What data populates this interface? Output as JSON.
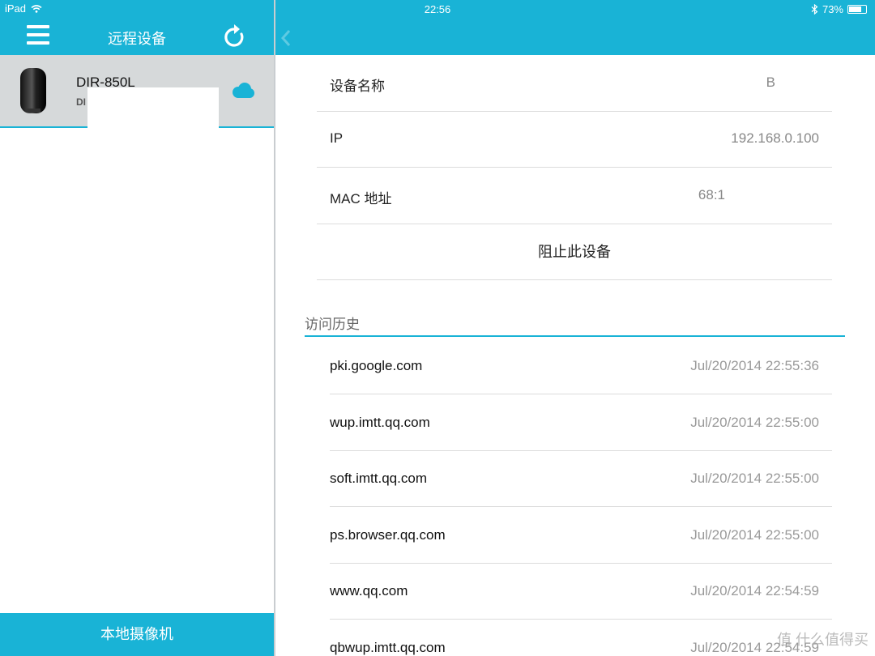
{
  "status_bar": {
    "carrier": "iPad",
    "time": "22:56",
    "battery": "73%"
  },
  "left_pane": {
    "title": "远程设备",
    "device": {
      "name": "DIR-850L",
      "subtitle": "DI"
    },
    "footer_label": "本地摄像机"
  },
  "detail": {
    "rows": [
      {
        "label": "设备名称",
        "value": "B"
      },
      {
        "label": "IP",
        "value": "192.168.0.100"
      },
      {
        "label": "MAC 地址",
        "value": "68:1"
      }
    ],
    "block_label": "阻止此设备",
    "history_title": "访问历史",
    "history": [
      {
        "domain": "pki.google.com",
        "time": "Jul/20/2014 22:55:36"
      },
      {
        "domain": "wup.imtt.qq.com",
        "time": "Jul/20/2014 22:55:00"
      },
      {
        "domain": "soft.imtt.qq.com",
        "time": "Jul/20/2014 22:55:00"
      },
      {
        "domain": "ps.browser.qq.com",
        "time": "Jul/20/2014 22:55:00"
      },
      {
        "domain": "www.qq.com",
        "time": "Jul/20/2014 22:54:59"
      },
      {
        "domain": "qbwup.imtt.qq.com",
        "time": "Jul/20/2014 22:54:59"
      }
    ]
  },
  "watermark": "值 什么值得买",
  "colors": {
    "accent": "#19b3d6",
    "selected_row": "#d6d9da"
  },
  "icons": {
    "menu": "menu-icon",
    "refresh": "refresh-icon",
    "cloud": "cloud-icon",
    "wifi": "wifi-icon",
    "bluetooth": "bluetooth-icon",
    "battery": "battery-icon"
  }
}
